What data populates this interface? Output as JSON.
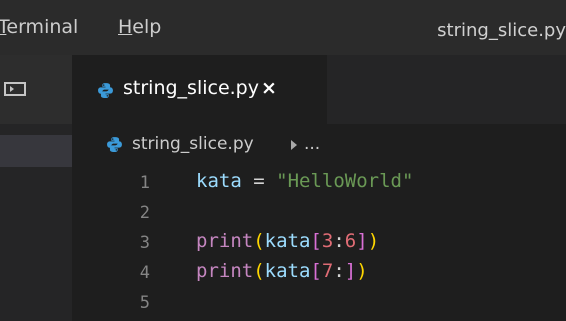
{
  "menubar": {
    "items": [
      {
        "label": "Terminal"
      },
      {
        "label": "Help"
      }
    ],
    "window_title": "string_slice.py"
  },
  "tabs": [
    {
      "label": "string_slice.py",
      "close": "×",
      "active": true,
      "icon": "python-icon"
    }
  ],
  "breadcrumbs": {
    "file": "string_slice.py",
    "more": "..."
  },
  "editor": {
    "lines": [
      {
        "no": "1",
        "tokens": [
          {
            "t": "kata",
            "k": "ident"
          },
          {
            "t": " ",
            "k": "plain"
          },
          {
            "t": "=",
            "k": "eq"
          },
          {
            "t": " ",
            "k": "plain"
          },
          {
            "t": "\"HelloWorld\"",
            "k": "str"
          }
        ]
      },
      {
        "no": "2",
        "tokens": []
      },
      {
        "no": "3",
        "tokens": [
          {
            "t": "print",
            "k": "fn"
          },
          {
            "t": "(",
            "k": "paren"
          },
          {
            "t": "kata",
            "k": "ident"
          },
          {
            "t": "[",
            "k": "bracket"
          },
          {
            "t": "3",
            "k": "num"
          },
          {
            "t": ":",
            "k": "plain"
          },
          {
            "t": "6",
            "k": "num"
          },
          {
            "t": "]",
            "k": "bracket"
          },
          {
            "t": ")",
            "k": "paren"
          }
        ]
      },
      {
        "no": "4",
        "tokens": [
          {
            "t": "print",
            "k": "fn"
          },
          {
            "t": "(",
            "k": "paren"
          },
          {
            "t": "kata",
            "k": "ident"
          },
          {
            "t": "[",
            "k": "bracket"
          },
          {
            "t": "7",
            "k": "num"
          },
          {
            "t": ":",
            "k": "plain"
          },
          {
            "t": "]",
            "k": "bracket"
          },
          {
            "t": ")",
            "k": "paren"
          }
        ]
      },
      {
        "no": "5",
        "tokens": []
      }
    ]
  },
  "colors": {
    "editor_bg": "#1e1e1e",
    "menubar_bg": "#2b2b2b",
    "string": "#6a9955",
    "function": "#c586c0",
    "number": "#e06c75"
  }
}
